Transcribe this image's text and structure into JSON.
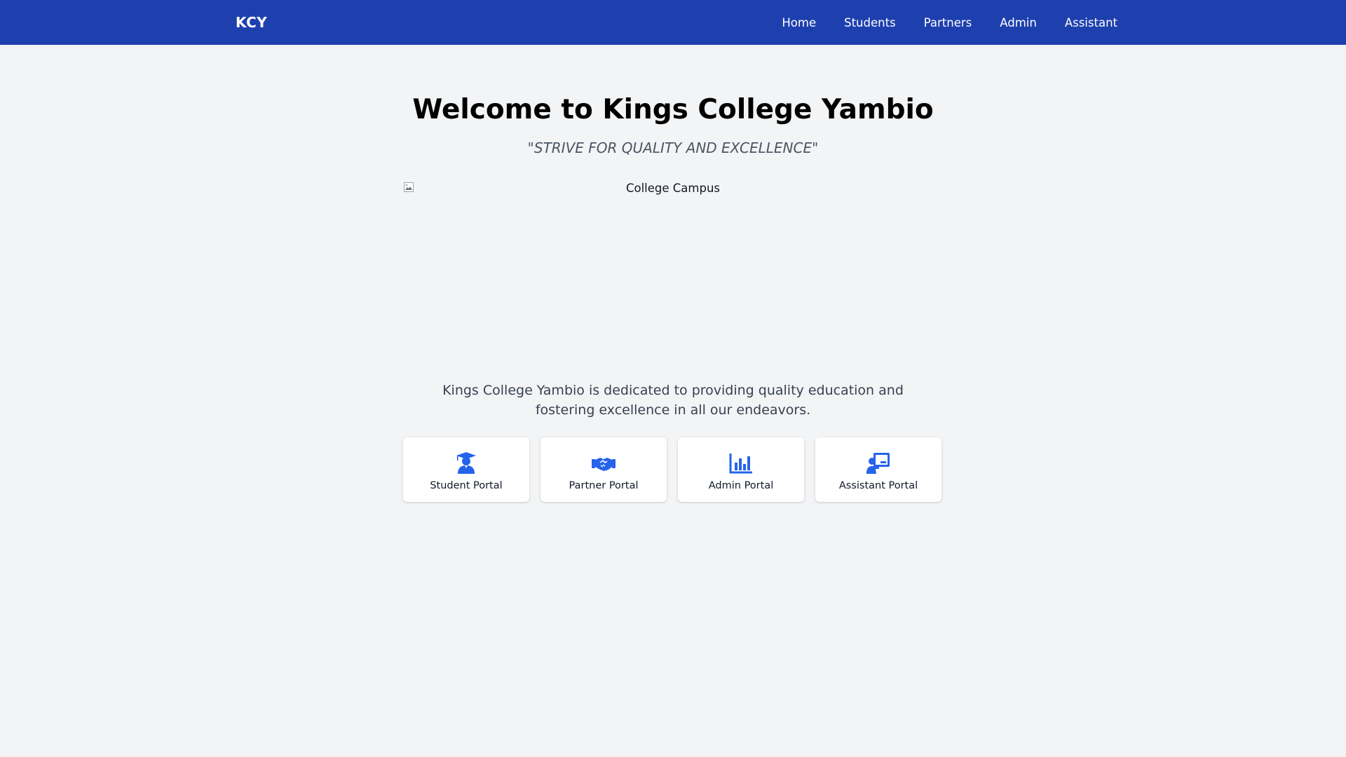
{
  "nav": {
    "brand": "KCY",
    "links": [
      {
        "label": "Home"
      },
      {
        "label": "Students"
      },
      {
        "label": "Partners"
      },
      {
        "label": "Admin"
      },
      {
        "label": "Assistant"
      }
    ]
  },
  "hero": {
    "title": "Welcome to Kings College Yambio",
    "tagline": "\"STRIVE FOR QUALITY AND EXCELLENCE\"",
    "image_alt": "College Campus",
    "description": "Kings College Yambio is dedicated to providing quality education and fostering excellence in all our endeavors."
  },
  "portals": [
    {
      "label": "Student Portal",
      "icon": "user-graduate-icon"
    },
    {
      "label": "Partner Portal",
      "icon": "handshake-icon"
    },
    {
      "label": "Admin Portal",
      "icon": "chart-bar-icon"
    },
    {
      "label": "Assistant Portal",
      "icon": "chalkboard-teacher-icon"
    }
  ],
  "colors": {
    "navbar": "#1e40af",
    "accent": "#2563eb",
    "background": "#f3f4f6"
  }
}
